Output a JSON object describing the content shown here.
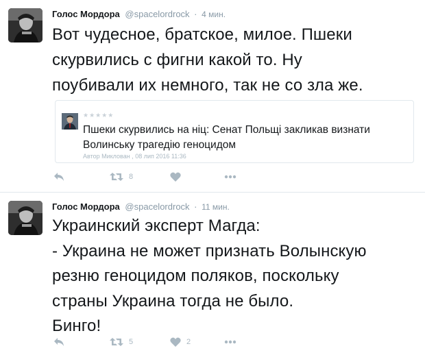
{
  "tweets": [
    {
      "author": {
        "name": "Голос Мордора",
        "handle": "@spacelordrock",
        "avatar_icon": "user-avatar"
      },
      "time": "4 мин.",
      "text": "Вот чудесное, братское, милое.  Пшеки\nскурвились с фигни какой то.  Ну\nпоубивали их немного,  так не со зла же.",
      "quote": {
        "stars": "★★★★★",
        "title": "Пшеки скурвились на ніц: Сенат Польщі закликав визнати\nВолинську трагедію геноцидом",
        "meta": "Автор Миклован , 08 лип 2016 11:36"
      },
      "actions": {
        "reply_icon": "reply-icon",
        "retweet_icon": "retweet-icon",
        "retweet_count": "8",
        "like_icon": "heart-icon",
        "like_count": "",
        "more_icon": "more-icon"
      }
    },
    {
      "author": {
        "name": "Голос Мордора",
        "handle": "@spacelordrock",
        "avatar_icon": "user-avatar"
      },
      "time": "11 мин.",
      "text": "Украинский  эксперт Магда:\n- Украина не может признать Волынскую\nрезню геноцидом поляков, поскольку\nстраны Украина тогда не было.\nБинго!",
      "actions": {
        "reply_icon": "reply-icon",
        "retweet_icon": "retweet-icon",
        "retweet_count": "5",
        "like_icon": "heart-icon",
        "like_count": "2",
        "more_icon": "more-icon"
      }
    }
  ],
  "colors": {
    "text": "#14171a",
    "muted": "#8899a6",
    "icon": "#aab8c2",
    "border": "#e1e8ed"
  }
}
